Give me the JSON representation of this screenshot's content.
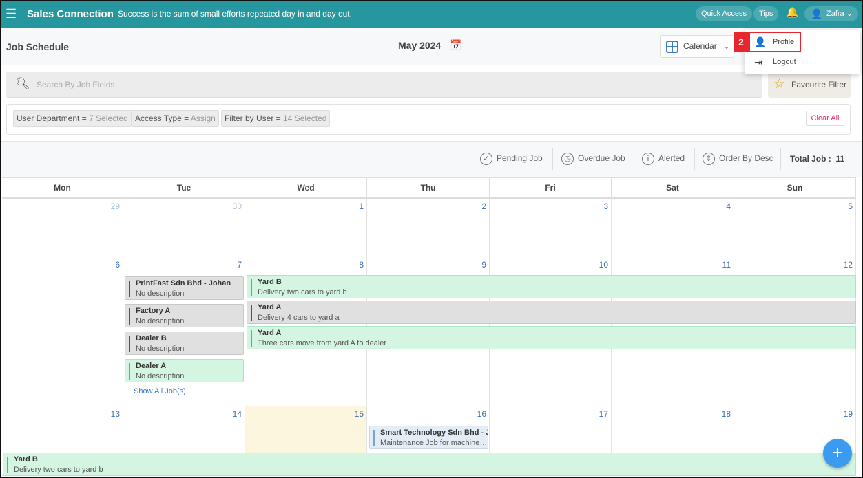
{
  "topbar": {
    "brand": "Sales Connection",
    "quote": "Success is the sum of small efforts repeated day in and day out.",
    "quick_access": "Quick Access",
    "tips": "Tips",
    "user": "Zafra"
  },
  "header": {
    "title": "Job Schedule",
    "month": "May 2024",
    "view": "Calendar"
  },
  "user_menu": {
    "badge": "2",
    "items": [
      {
        "label": "Profile",
        "icon": "person-icon"
      },
      {
        "label": "Logout",
        "icon": "logout-icon"
      }
    ]
  },
  "search": {
    "placeholder": "Search By Job Fields"
  },
  "favourite_filter": "Favourite Filter",
  "filters": [
    {
      "label": "User Department",
      "value": "7 Selected"
    },
    {
      "label": "Access Type",
      "value": "Assign"
    },
    {
      "label": "Filter by User",
      "value": "14 Selected"
    }
  ],
  "clear_all": "Clear All",
  "legend": {
    "pending": "Pending Job",
    "overdue": "Overdue Job",
    "alerted": "Alerted",
    "order": "Order By Desc",
    "total_label": "Total Job :",
    "total_value": "11"
  },
  "days": [
    "Mon",
    "Tue",
    "Wed",
    "Thu",
    "Fri",
    "Sat",
    "Sun"
  ],
  "weeks": [
    [
      "29",
      "30",
      "1",
      "2",
      "3",
      "4",
      "5"
    ],
    [
      "6",
      "7",
      "8",
      "9",
      "10",
      "11",
      "12"
    ],
    [
      "13",
      "14",
      "15",
      "16",
      "17",
      "18",
      "19"
    ]
  ],
  "events": [
    {
      "title": "PrintFast Sdn Bhd - Johan",
      "desc": "No description",
      "color": "grey"
    },
    {
      "title": "Factory A",
      "desc": "No description",
      "color": "grey"
    },
    {
      "title": "Dealer B",
      "desc": "No description",
      "color": "grey"
    },
    {
      "title": "Dealer A",
      "desc": "No description",
      "color": "green"
    },
    {
      "title": "Yard B",
      "desc": "Delivery two cars to yard b",
      "color": "green"
    },
    {
      "title": "Yard A",
      "desc": "Delivery 4 cars to yard a",
      "color": "grey"
    },
    {
      "title": "Yard A",
      "desc": "Three cars move from yard A to dealer",
      "color": "green"
    },
    {
      "title": "Smart Technology Sdn Bhd - Ja...",
      "desc": "Maintenance Job for machine e...",
      "color": "blue"
    },
    {
      "title": "Yard B",
      "desc": "Delivery two cars to yard b",
      "color": "green"
    }
  ],
  "show_all": "Show All Job(s)",
  "fab": "+"
}
